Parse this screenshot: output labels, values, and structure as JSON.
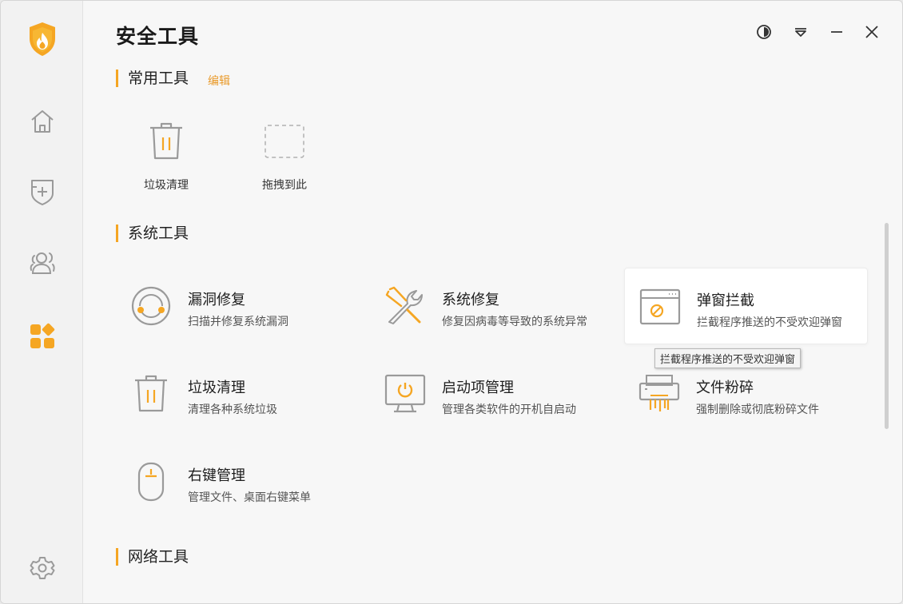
{
  "app": {
    "title": "安全工具"
  },
  "window_controls": [
    "theme-icon",
    "menu-dropdown-icon",
    "minimize-icon",
    "close-icon"
  ],
  "sidebar": {
    "items": [
      {
        "icon": "flame-shield-logo-icon"
      },
      {
        "icon": "home-icon"
      },
      {
        "icon": "shield-plus-icon"
      },
      {
        "icon": "users-icon"
      },
      {
        "icon": "apps-grid-icon",
        "active": true
      },
      {
        "icon": "settings-gear-icon"
      }
    ]
  },
  "sections": {
    "common": {
      "title": "常用工具",
      "edit_label": "编辑",
      "tools": [
        {
          "label": "垃圾清理",
          "icon": "trash-icon"
        },
        {
          "label": "拖拽到此",
          "icon": "drop-placeholder-icon"
        }
      ]
    },
    "system": {
      "title": "系统工具",
      "tools": [
        {
          "name": "漏洞修复",
          "desc": "扫描并修复系统漏洞",
          "icon": "vulnerability-fix-icon"
        },
        {
          "name": "系统修复",
          "desc": "修复因病毒等导致的系统异常",
          "icon": "wrench-screwdriver-icon"
        },
        {
          "name": "弹窗拦截",
          "desc": "拦截程序推送的不受欢迎弹窗",
          "icon": "popup-block-icon"
        },
        {
          "name": "垃圾清理",
          "desc": "清理各种系统垃圾",
          "icon": "trash-icon"
        },
        {
          "name": "启动项管理",
          "desc": "管理各类软件的开机自启动",
          "icon": "startup-monitor-icon"
        },
        {
          "name": "文件粉碎",
          "desc": "强制删除或彻底粉碎文件",
          "icon": "shredder-icon"
        },
        {
          "name": "右键管理",
          "desc": "管理文件、桌面右键菜单",
          "icon": "mouse-icon"
        }
      ]
    },
    "network": {
      "title": "网络工具"
    }
  },
  "tooltip": {
    "text": "拦截程序推送的不受欢迎弹窗"
  },
  "colors": {
    "accent": "#f5a623",
    "icon_gray": "#9a9a9a",
    "link": "#e99a2a"
  }
}
